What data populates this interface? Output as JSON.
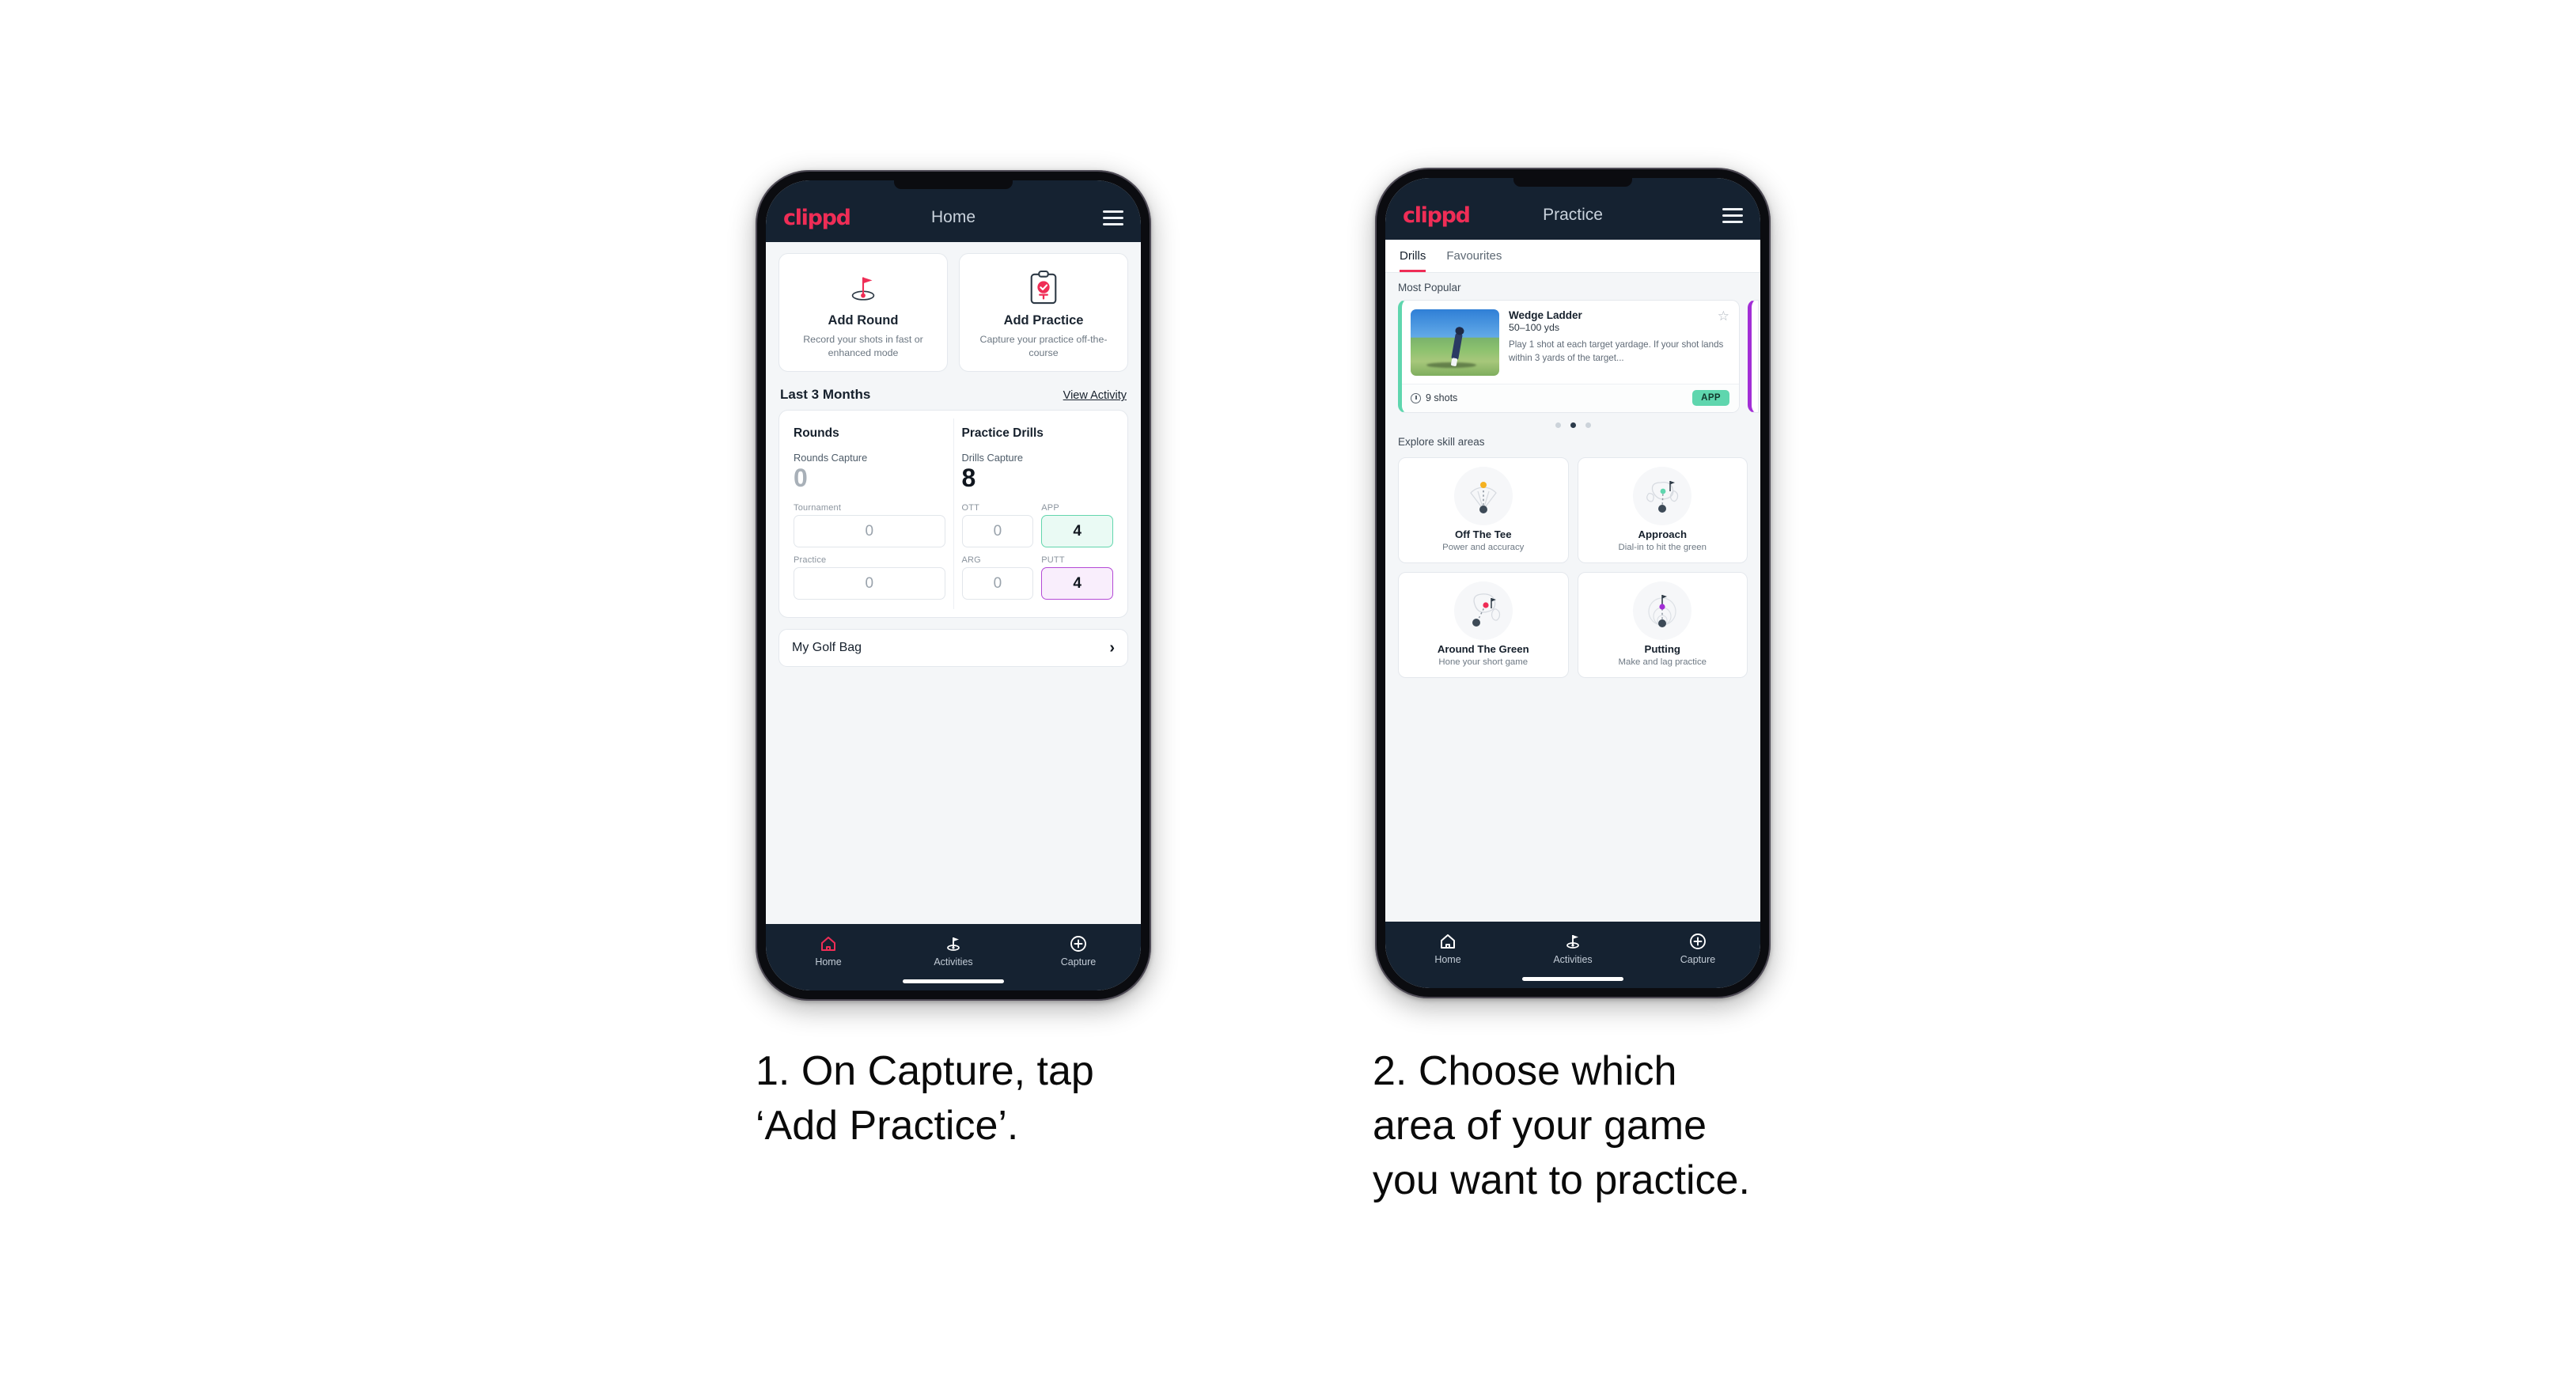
{
  "colors": {
    "brand_pink": "#ef2d56",
    "appbar_dark": "#152231",
    "accent_green": "#5fd6ae",
    "accent_purple": "#a22ed6",
    "page_bg": "#f4f6f8"
  },
  "phone1": {
    "appbar": {
      "brand": "clippd",
      "title": "Home",
      "menu_icon": "hamburger-icon"
    },
    "quick_actions": [
      {
        "icon": "golf-flag-hole-icon",
        "title": "Add Round",
        "subtitle": "Record your shots in fast or enhanced mode"
      },
      {
        "icon": "clipboard-check-icon",
        "title": "Add Practice",
        "subtitle": "Capture your practice off-the-course"
      }
    ],
    "section": {
      "title": "Last 3 Months",
      "link": "View Activity"
    },
    "stats": {
      "rounds": {
        "heading": "Rounds",
        "capture_label": "Rounds Capture",
        "capture_value": "0",
        "metrics": [
          {
            "label": "Tournament",
            "value": "0",
            "state": "empty"
          },
          {
            "label": "Practice",
            "value": "0",
            "state": "empty"
          }
        ]
      },
      "drills": {
        "heading": "Practice Drills",
        "capture_label": "Drills Capture",
        "capture_value": "8",
        "metrics": [
          {
            "label": "OTT",
            "value": "0",
            "state": "empty"
          },
          {
            "label": "APP",
            "value": "4",
            "state": "green"
          },
          {
            "label": "ARG",
            "value": "0",
            "state": "empty"
          },
          {
            "label": "PUTT",
            "value": "4",
            "state": "purple"
          }
        ]
      }
    },
    "golf_bag": {
      "label": "My Golf Bag",
      "chevron": "chevron-right-icon"
    },
    "bottom_nav": [
      {
        "label": "Home",
        "icon": "home-icon",
        "active": true
      },
      {
        "label": "Activities",
        "icon": "golf-flag-icon",
        "active": false
      },
      {
        "label": "Capture",
        "icon": "plus-circle-icon",
        "active": false
      }
    ]
  },
  "phone2": {
    "appbar": {
      "brand": "clippd",
      "title": "Practice",
      "menu_icon": "hamburger-icon"
    },
    "tabs": [
      {
        "label": "Drills",
        "active": true
      },
      {
        "label": "Favourites",
        "active": false
      }
    ],
    "most_popular": {
      "heading": "Most Popular",
      "card": {
        "title": "Wedge Ladder",
        "yardage": "50–100 yds",
        "description": "Play 1 shot at each target yardage. If your shot lands within 3 yards of the target...",
        "shots": "9 shots",
        "tag": "APP",
        "star_icon": "star-outline-icon",
        "clock_icon": "clock-icon",
        "thumbnail": "golfer-chipping-photo"
      },
      "dots": {
        "count": 3,
        "active_index": 1
      }
    },
    "explore": {
      "heading": "Explore skill areas",
      "cards": [
        {
          "name": "Off The Tee",
          "sub": "Power and accuracy",
          "icon": "tee-dispersion-icon"
        },
        {
          "name": "Approach",
          "sub": "Dial-in to hit the green",
          "icon": "green-approach-icon"
        },
        {
          "name": "Around The Green",
          "sub": "Hone your short game",
          "icon": "chip-to-green-icon"
        },
        {
          "name": "Putting",
          "sub": "Make and lag practice",
          "icon": "putting-rings-icon"
        }
      ]
    },
    "bottom_nav": [
      {
        "label": "Home",
        "icon": "home-icon",
        "active": false
      },
      {
        "label": "Activities",
        "icon": "golf-flag-icon",
        "active": true
      },
      {
        "label": "Capture",
        "icon": "plus-circle-icon",
        "active": false
      }
    ]
  },
  "captions": {
    "one": "1. On Capture, tap\n‘Add Practice’.",
    "two": "2. Choose which\narea of your game\nyou want to practice."
  }
}
